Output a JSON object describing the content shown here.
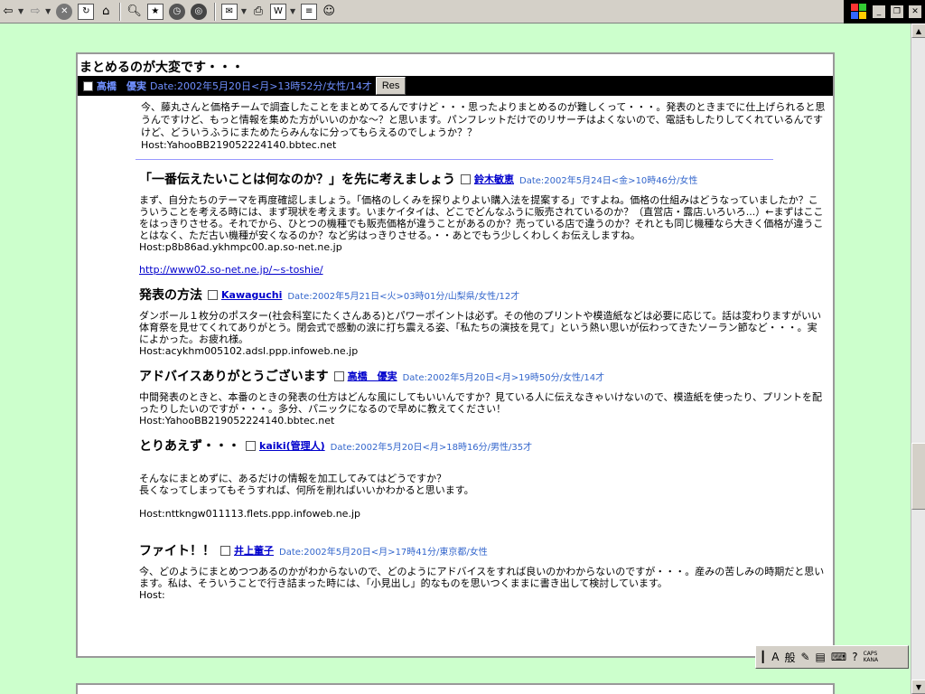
{
  "toolbar": {
    "back_icon": "back-arrow-icon",
    "forward_icon": "forward-arrow-icon"
  },
  "thread": {
    "title": "まとめるのが大変です・・・",
    "author": "高橋　優実",
    "date": "Date:2002年5月20日<月>13時52分/女性/14才",
    "res_label": "Res",
    "body": "今、藤丸さんと価格チームで調査したことをまとめてるんですけど・・・思ったよりまとめるのが難しくって・・・。発表のときまでに仕上げられると思うんですけど、もっと情報を集めた方がいいのかな～？と思います。パンフレットだけでのリサーチはよくないので、電話もしたりしてくれているんですけど、どういうふうにまためたらみんなに分ってもらえるのでしょうか？？",
    "host": "Host:YahooBB219052224140.bbtec.net"
  },
  "replies": [
    {
      "title": "「一番伝えたいことは何なのか？」を先に考えましょう",
      "author": "鈴木敏恵",
      "date": "Date:2002年5月24日<金>10時46分/女性",
      "body": "まず、自分たちのテーマを再度確認しましょう。「価格のしくみを探りよりよい購入法を提案する」ですよね。価格の仕組みはどうなっていましたか？こういうことを考える時には、まず現状を考えます。いまケイタイは、どこでどんなふうに販売されているのか？（直営店・露店.いろいろ...）←まずはここをはっきりさせる。それでから、ひとつの機種でも販売価格が違うことがあるのか？売っている店で違うのか？それとも同じ機種なら大きく価格が違うことはなく、ただ古い機種が安くなるのか？など劣はっきりさせる。・・あとでもう少しくわしくお伝えしますね。",
      "host": "Host:p8b86ad.ykhmpc00.ap.so-net.ne.jp",
      "link": "http://www02.so-net.ne.jp/~s-toshie/"
    },
    {
      "title": "発表の方法",
      "author": "Kawaguchi",
      "date": "Date:2002年5月21日<火>03時01分/山梨県/女性/12才",
      "body": "ダンボール１枚分のポスター(社会科室にたくさんある)とパワーポイントは必ず。その他のプリントや模造紙などは必要に応じて。話は変わりますがいい体育祭を見せてくれてありがとう。閉会式で感動の涙に打ち震える姿、「私たちの演技を見て」という熱い思いが伝わってきたソーラン節など・・・。実によかった。お疲れ様。",
      "host": "Host:acykhm005102.adsl.ppp.infoweb.ne.jp"
    },
    {
      "title": "アドバイスありがとうございます",
      "author": "高橋　優実",
      "date": "Date:2002年5月20日<月>19時50分/女性/14才",
      "body": "中間発表のときと、本番のときの発表の仕方はどんな風にしてもいいんですか？見ている人に伝えなきゃいけないので、模造紙を使ったり、プリントを配ったりしたいのですが・・・。多分、パニックになるので早めに教えてください！",
      "host": "Host:YahooBB219052224140.bbtec.net"
    },
    {
      "title": "とりあえず・・・",
      "author": "kaiki(管理人)",
      "date": "Date:2002年5月20日<月>18時16分/男性/35才",
      "body": "そんなにまとめずに、あるだけの情報を加工してみてはどうですか？\n長くなってしまってもそうすれば、何所を削ればいいかわかると思います。",
      "host": "Host:nttkngw011113.flets.ppp.infoweb.ne.jp"
    },
    {
      "title": "ファイト！！",
      "author": "井上董子",
      "date": "Date:2002年5月20日<月>17時41分/東京都/女性",
      "body": "今、どのようにまとめつつあるのかがわからないので、どのようにアドバイスをすれば良いのかわからないのですが・・・。産みの苦しみの時期だと思います。私は、そういうことで行き詰まった時には、「小見出し」的なものを思いつくままに書き出して検討しています。",
      "host": "Host:"
    }
  ],
  "ime": {
    "mode": "A",
    "kanji": "般",
    "caps": "CAPS",
    "kana": "KANA"
  },
  "colors": {
    "page_bg": "#ccffcc",
    "meta_bar": "#000000",
    "author_link": "#0000cc",
    "date_text": "#3366cc",
    "divider": "#9999ff"
  }
}
